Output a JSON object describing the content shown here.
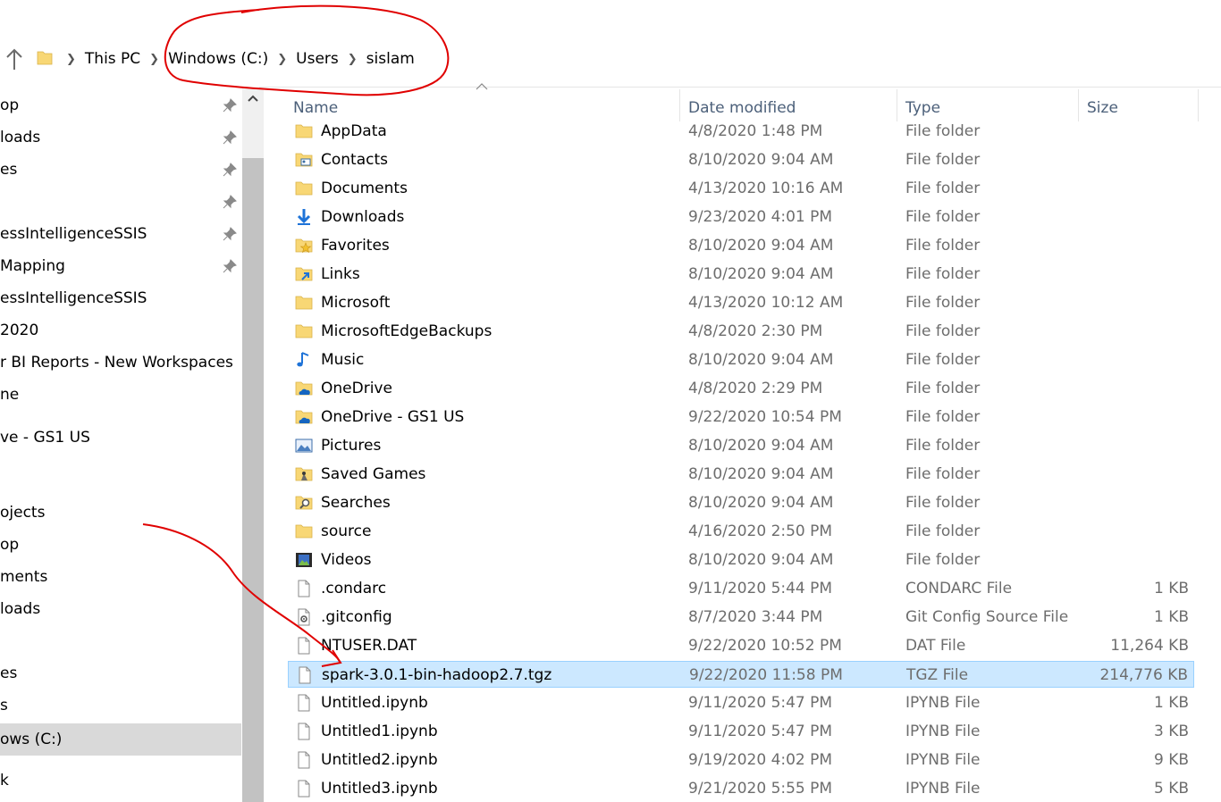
{
  "breadcrumb": [
    "This PC",
    "Windows (C:)",
    "Users",
    "sislam"
  ],
  "sidebar": {
    "items": [
      {
        "label": "op",
        "pinned": true
      },
      {
        "label": "loads",
        "pinned": true
      },
      {
        "label": "es",
        "pinned": true
      },
      {
        "label": "",
        "pinned": true
      },
      {
        "label": "essIntelligenceSSIS",
        "pinned": true
      },
      {
        "label": "Mapping",
        "pinned": true
      },
      {
        "label": "essIntelligenceSSIS",
        "pinned": false
      },
      {
        "label": "2020",
        "pinned": false
      },
      {
        "label": "r BI Reports - New Workspaces",
        "pinned": false
      },
      {
        "label": "ne",
        "pinned": false
      },
      {
        "label": "ve - GS1 US",
        "pinned": false
      },
      {
        "label": "ojects",
        "pinned": false
      },
      {
        "label": "op",
        "pinned": false
      },
      {
        "label": "ments",
        "pinned": false
      },
      {
        "label": "loads",
        "pinned": false
      },
      {
        "label": "es",
        "pinned": false
      },
      {
        "label": "s",
        "pinned": false
      },
      {
        "label": "ows (C:)",
        "pinned": false,
        "selected": true
      },
      {
        "label": "k",
        "pinned": false
      }
    ]
  },
  "columns": {
    "name": "Name",
    "date": "Date modified",
    "type": "Type",
    "size": "Size"
  },
  "files": [
    {
      "name": "AppData",
      "date": "4/8/2020 1:48 PM",
      "type": "File folder",
      "size": "",
      "icon": "folder-icon"
    },
    {
      "name": "Contacts",
      "date": "8/10/2020 9:04 AM",
      "type": "File folder",
      "size": "",
      "icon": "contacts-folder-icon"
    },
    {
      "name": "Documents",
      "date": "4/13/2020 10:16 AM",
      "type": "File folder",
      "size": "",
      "icon": "folder-icon"
    },
    {
      "name": "Downloads",
      "date": "9/23/2020 4:01 PM",
      "type": "File folder",
      "size": "",
      "icon": "download-arrow-icon"
    },
    {
      "name": "Favorites",
      "date": "8/10/2020 9:04 AM",
      "type": "File folder",
      "size": "",
      "icon": "favorites-folder-icon"
    },
    {
      "name": "Links",
      "date": "8/10/2020 9:04 AM",
      "type": "File folder",
      "size": "",
      "icon": "links-folder-icon"
    },
    {
      "name": "Microsoft",
      "date": "4/13/2020 10:12 AM",
      "type": "File folder",
      "size": "",
      "icon": "folder-icon"
    },
    {
      "name": "MicrosoftEdgeBackups",
      "date": "4/8/2020 2:30 PM",
      "type": "File folder",
      "size": "",
      "icon": "folder-icon"
    },
    {
      "name": "Music",
      "date": "8/10/2020 9:04 AM",
      "type": "File folder",
      "size": "",
      "icon": "music-note-icon"
    },
    {
      "name": "OneDrive",
      "date": "4/8/2020 2:29 PM",
      "type": "File folder",
      "size": "",
      "icon": "onedrive-folder-icon"
    },
    {
      "name": "OneDrive - GS1 US",
      "date": "9/22/2020 10:54 PM",
      "type": "File folder",
      "size": "",
      "icon": "onedrive-folder-icon"
    },
    {
      "name": "Pictures",
      "date": "8/10/2020 9:04 AM",
      "type": "File folder",
      "size": "",
      "icon": "pictures-icon"
    },
    {
      "name": "Saved Games",
      "date": "8/10/2020 9:04 AM",
      "type": "File folder",
      "size": "",
      "icon": "saved-games-icon"
    },
    {
      "name": "Searches",
      "date": "8/10/2020 9:04 AM",
      "type": "File folder",
      "size": "",
      "icon": "searches-folder-icon"
    },
    {
      "name": "source",
      "date": "4/16/2020 2:50 PM",
      "type": "File folder",
      "size": "",
      "icon": "folder-icon"
    },
    {
      "name": "Videos",
      "date": "8/10/2020 9:04 AM",
      "type": "File folder",
      "size": "",
      "icon": "videos-icon"
    },
    {
      "name": ".condarc",
      "date": "9/11/2020 5:44 PM",
      "type": "CONDARC File",
      "size": "1 KB",
      "icon": "file-icon"
    },
    {
      "name": ".gitconfig",
      "date": "8/7/2020 3:44 PM",
      "type": "Git Config Source File",
      "size": "1 KB",
      "icon": "config-file-icon"
    },
    {
      "name": "NTUSER.DAT",
      "date": "9/22/2020 10:52 PM",
      "type": "DAT File",
      "size": "11,264 KB",
      "icon": "file-icon"
    },
    {
      "name": "spark-3.0.1-bin-hadoop2.7.tgz",
      "date": "9/22/2020 11:58 PM",
      "type": "TGZ File",
      "size": "214,776 KB",
      "icon": "file-icon",
      "selected": true
    },
    {
      "name": "Untitled.ipynb",
      "date": "9/11/2020 5:47 PM",
      "type": "IPYNB File",
      "size": "1 KB",
      "icon": "file-icon"
    },
    {
      "name": "Untitled1.ipynb",
      "date": "9/11/2020 5:47 PM",
      "type": "IPYNB File",
      "size": "3 KB",
      "icon": "file-icon"
    },
    {
      "name": "Untitled2.ipynb",
      "date": "9/19/2020 4:02 PM",
      "type": "IPYNB File",
      "size": "9 KB",
      "icon": "file-icon"
    },
    {
      "name": "Untitled3.ipynb",
      "date": "9/21/2020 5:55 PM",
      "type": "IPYNB File",
      "size": "5 KB",
      "icon": "file-icon"
    }
  ],
  "colors": {
    "selection": "#cce8ff",
    "selection_border": "#99d1ff",
    "header_text": "#4c607a",
    "secondary_text": "#6d6d6d",
    "annotation_red": "#e00000",
    "folder_yellow": "#f8d775"
  },
  "annotations": [
    "red-circle-around-breadcrumb",
    "red-arrow-to-spark-file"
  ]
}
